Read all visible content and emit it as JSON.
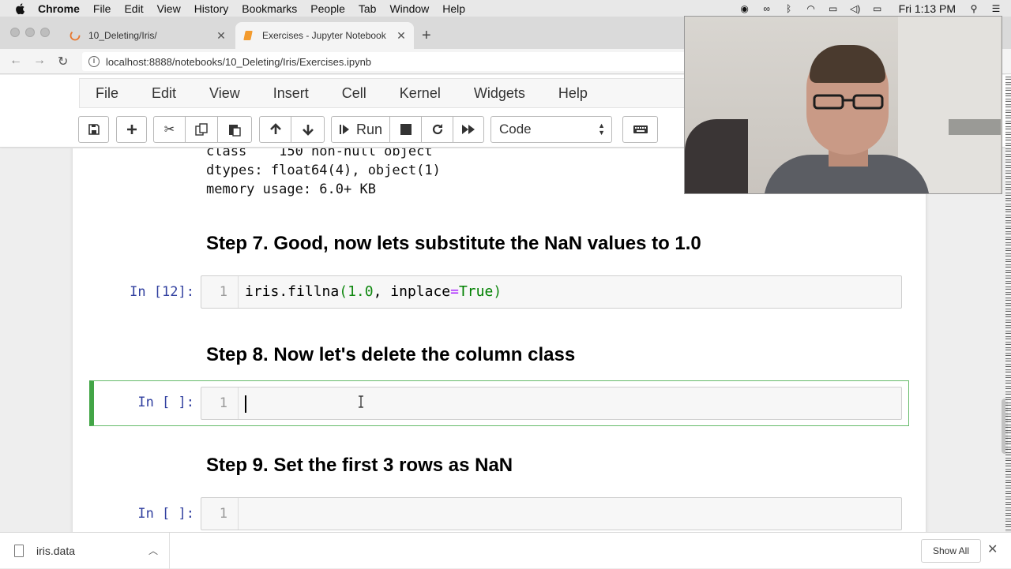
{
  "mac_menubar": {
    "app": "Chrome",
    "items": [
      "File",
      "Edit",
      "View",
      "History",
      "Bookmarks",
      "People",
      "Tab",
      "Window",
      "Help"
    ],
    "clock": "Fri 1:13 PM"
  },
  "tabs": [
    {
      "title": "10_Deleting/Iris/",
      "active": false
    },
    {
      "title": "Exercises - Jupyter Notebook",
      "active": true
    }
  ],
  "address_bar": {
    "url": "localhost:8888/notebooks/10_Deleting/Iris/Exercises.ipynb"
  },
  "jupyter": {
    "menu": [
      "File",
      "Edit",
      "View",
      "Insert",
      "Cell",
      "Kernel",
      "Widgets",
      "Help"
    ],
    "toolbar": {
      "run_label": "Run",
      "cell_type": "Code",
      "icons": [
        "save-icon",
        "plus-icon",
        "cut-icon",
        "copy-icon",
        "paste-icon",
        "arrow-up-icon",
        "arrow-down-icon",
        "step-run-icon",
        "stop-icon",
        "restart-icon",
        "fast-forward-icon",
        "keyboard-icon"
      ]
    }
  },
  "notebook": {
    "output_lines": [
      "class    150 non-null object",
      "dtypes: float64(4), object(1)",
      "memory usage: 6.0+ KB"
    ],
    "step7": "Step 7. Good, now lets substitute the NaN values to 1.0",
    "cell12": {
      "prompt": "In [12]:",
      "line": "1",
      "code_fn": "iris.fillna",
      "code_num": "1.0",
      "code_kw": "inplace",
      "code_val": "True"
    },
    "step8": "Step 8. Now let's delete the column class",
    "cell_active": {
      "prompt": "In [ ]:",
      "line": "1",
      "code": ""
    },
    "step9": "Step 9. Set the first 3 rows as NaN",
    "cell_next": {
      "prompt": "In [ ]:",
      "line": "1",
      "code": ""
    }
  },
  "download_bar": {
    "file": "iris.data",
    "show_all": "Show All"
  },
  "colors": {
    "prompt_blue": "#303f9f",
    "selected_green": "#42a546",
    "code_green": "#108810",
    "equals_purple": "#aa22ff"
  }
}
